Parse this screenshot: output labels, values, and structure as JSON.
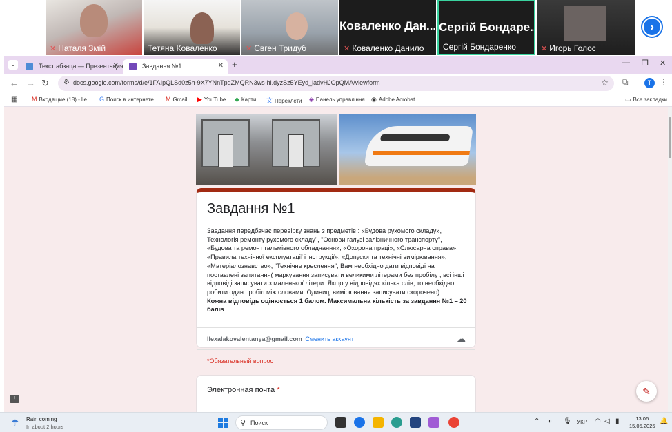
{
  "meeting": {
    "participants": [
      {
        "name": "Наталя Змій",
        "muted": true,
        "video": true
      },
      {
        "name": "Тетяна  Коваленко",
        "muted": false,
        "video": true
      },
      {
        "name": "Євген Тридуб",
        "muted": true,
        "video": true
      },
      {
        "name": "Коваленко Данило",
        "title": "Коваленко  Дан...",
        "muted": true,
        "video": false
      },
      {
        "name": "Сергій Бондаренко",
        "title": "Сергій  Бондаре...",
        "muted": false,
        "video": false,
        "active": true
      },
      {
        "name": "Игорь Голос",
        "muted": true,
        "video": true
      }
    ],
    "next_icon": "chevron-right-icon"
  },
  "browser": {
    "tabs": [
      {
        "label": "Текст абзаца — Презентация",
        "favicon_color": "#4f8cd6",
        "active": false
      },
      {
        "label": "Завдання №1",
        "favicon_color": "#7248b9",
        "active": true
      }
    ],
    "new_tab": "+",
    "url": "docs.google.com/forms/d/e/1FAIpQLSd0z5h-9X7YNnTpqZMQRN3ws-hl.dyzSz5YEyd_ladvHJOpQMA/viewform",
    "profile_initial": "T",
    "bookmarks": [
      {
        "label": "Входящие (18) - lle...",
        "icon": "gmail-icon"
      },
      {
        "label": "Поиск в интернете...",
        "icon": "google-icon"
      },
      {
        "label": "Gmail",
        "icon": "gmail-icon"
      },
      {
        "label": "YouTube",
        "icon": "youtube-icon"
      },
      {
        "label": "Карти",
        "icon": "maps-icon"
      },
      {
        "label": "Переклсти",
        "icon": "translate-icon"
      },
      {
        "label": "Панель управління",
        "icon": "panel-icon"
      },
      {
        "label": "Adobe Acrobat",
        "icon": "acrobat-icon"
      }
    ],
    "all_bookmarks": "Все закладки"
  },
  "form": {
    "title": "Завдання №1",
    "description": "Завдання  передбачає перевірку знань з предметів : «Будова  рухомого складу», Технологія ремонту рухомого складу\",  \"Основи галузі залізничного транспорту\", «Будова та ремонт гальмівного обладнання», «Охорона праці», «Слюсарна справа», «Правила технічної експлуатації і інструкції», «Допуски та технічні вимірювання», «Матеріалознавство», \"Технічне креслення\",  Вам необхідно дати відповіді на поставлені запитання( маркування  записувати  великими літерами без пробілу , всі інші відповіді записувати з маленької літери. Якщо у відповідях кілька слів, то необхідно робити один пробіл між словами. Одиниці вимірювання записувати скорочено).",
    "scoring_note": "Кожна відповідь оцінюється 1 балом. Максимальна кількість за завдання №1  – 20 балів",
    "account_email": "llexalakovalentanya@gmail.com",
    "switch_account": "Сменить аккаунт",
    "required_note": "*Обязательный вопрос",
    "question_label": "Электронная почта",
    "required_star": "*"
  },
  "taskbar": {
    "weather_title": "Rain coming",
    "weather_sub": "In about 2 hours",
    "search_placeholder": "Поиск",
    "language": "УКР",
    "time": "13:06",
    "date": "15.05.2025"
  }
}
